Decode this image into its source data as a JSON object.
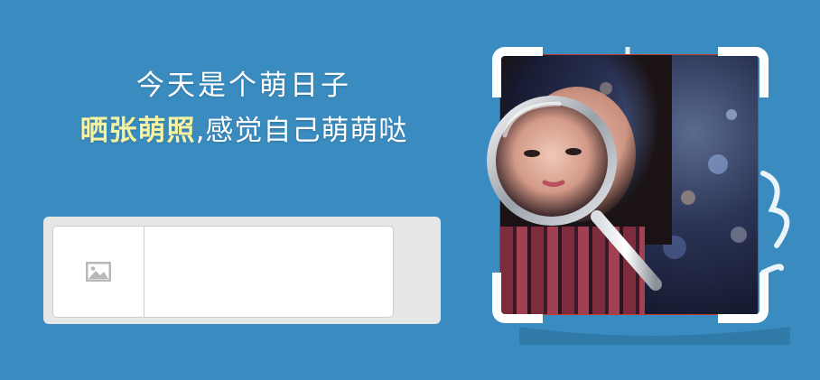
{
  "headline": {
    "line1": "今天是个萌日子",
    "line2_highlight": "晒张萌照",
    "line2_rest": ",感觉自己萌萌哒"
  },
  "upload": {
    "icon": "image-placeholder-icon",
    "text": ""
  },
  "photo": {
    "icon": "magnifier-icon",
    "frame_color": "#ffffff",
    "border_color": "#c0392b"
  },
  "colors": {
    "background": "#3a8bbf",
    "highlight": "#f6f3a0"
  }
}
